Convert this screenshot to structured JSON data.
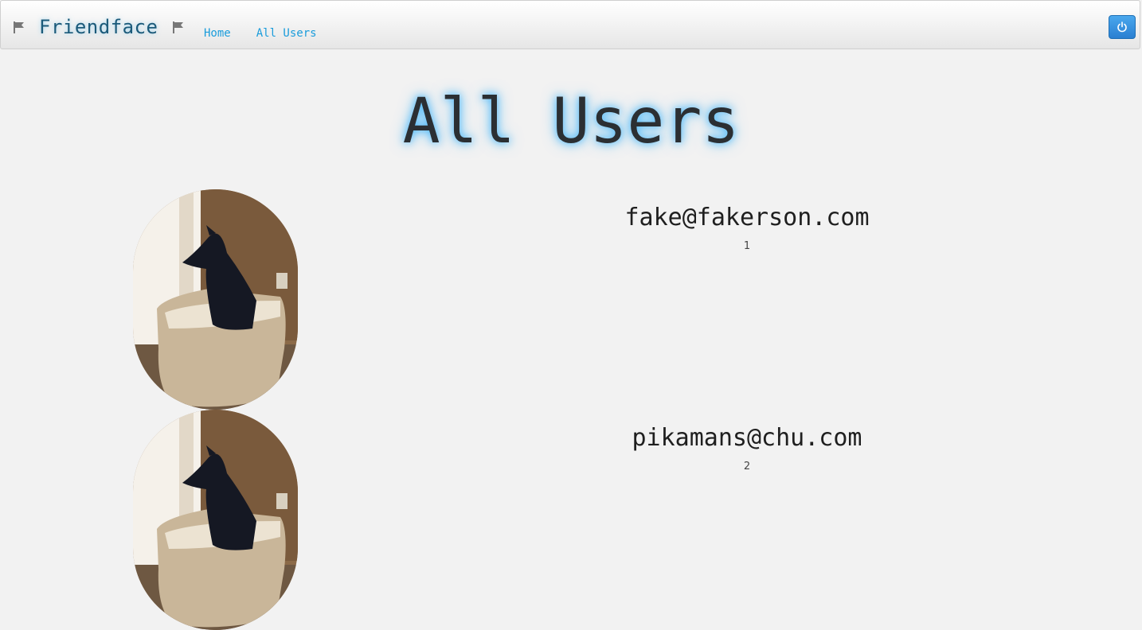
{
  "navbar": {
    "brand": "Friendface",
    "brand_icon": "flag-icon",
    "links": [
      {
        "label": "Home"
      },
      {
        "label": "All Users"
      }
    ],
    "power_icon": "power-icon",
    "accent_color": "#1a9cdb"
  },
  "page": {
    "title": "All Users"
  },
  "users": [
    {
      "email": "fake@fakerson.com",
      "id": "1",
      "avatar": "dog-photo"
    },
    {
      "email": "pikamans@chu.com",
      "id": "2",
      "avatar": "dog-photo"
    }
  ]
}
